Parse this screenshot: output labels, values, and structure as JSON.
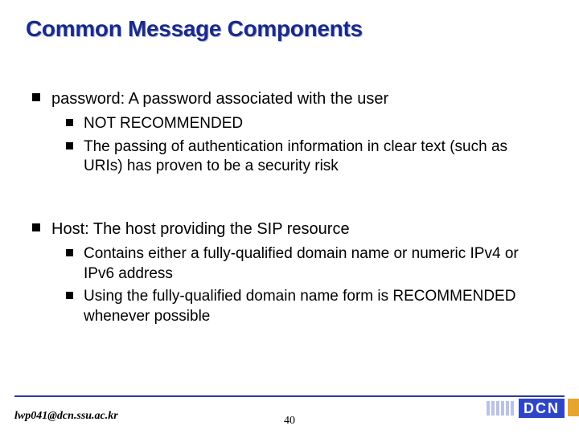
{
  "title": "Common Message Components",
  "bullets": {
    "l1": [
      {
        "text": "password: A password associated with the user",
        "children": [
          "NOT RECOMMENDED",
          "The passing of authentication information in clear text (such as URIs) has proven to be a security risk"
        ]
      },
      {
        "text": "Host: The host providing the SIP resource",
        "children": [
          "Contains either a fully-qualified domain name or numeric IPv4 or IPv6 address",
          "Using the fully-qualified domain name form is RECOMMENDED whenever possible"
        ]
      }
    ]
  },
  "footer": {
    "email": "lwp041@dcn.ssu.ac.kr",
    "page": "40",
    "logo_text": "DCN"
  }
}
